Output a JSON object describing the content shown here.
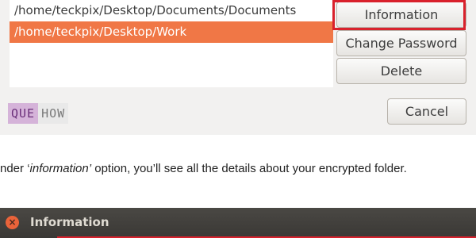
{
  "encrypted_folders_dialog": {
    "folders": [
      "/home/teckpix/Desktop/Documents/Documents",
      "/home/teckpix/Desktop/Work"
    ],
    "selected_index": 1,
    "buttons": {
      "information": "Information",
      "change_password": "Change Password",
      "delete": "Delete",
      "cancel": "Cancel"
    }
  },
  "logo": {
    "part1": "QUE",
    "part2": "HOW"
  },
  "caption": {
    "prefix": "nder ‘",
    "emphasis": "information’",
    "suffix": " option, you’ll see all the details about your encrypted folder."
  },
  "info_window": {
    "title": "Information",
    "close_glyph": "×"
  },
  "colors": {
    "selection": "#f07746",
    "highlight_box": "#d9212c",
    "titlebar": "#3c3b37",
    "close_button": "#e9633a"
  }
}
